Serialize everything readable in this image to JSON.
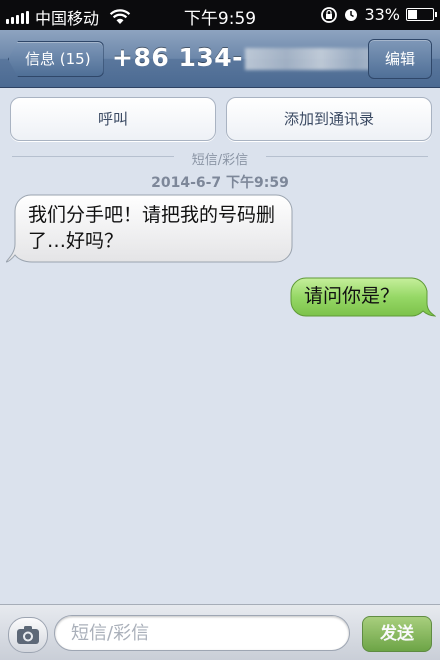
{
  "status_bar": {
    "carrier": "中国移动",
    "time": "下午9:59",
    "battery": "33%",
    "battery_level": 0.33
  },
  "nav": {
    "back_label": "信息 (15)",
    "title": "+86 134-",
    "edit_label": "编辑"
  },
  "actions": {
    "call_label": "呼叫",
    "add_contact_label": "添加到通讯录"
  },
  "thread": {
    "divider_label": "短信/彩信",
    "timestamp": "2014-6-7 下午9:59",
    "messages": [
      {
        "direction": "incoming",
        "text": "我们分手吧！请把我的号码删了…好吗？"
      },
      {
        "direction": "outgoing",
        "text": "请问你是？"
      }
    ]
  },
  "composer": {
    "placeholder": "短信/彩信",
    "send_label": "发送"
  },
  "colors": {
    "incoming_bubble": "#f2f2f2",
    "outgoing_bubble": "#8fd15a",
    "nav_bar": "#5b789e"
  }
}
